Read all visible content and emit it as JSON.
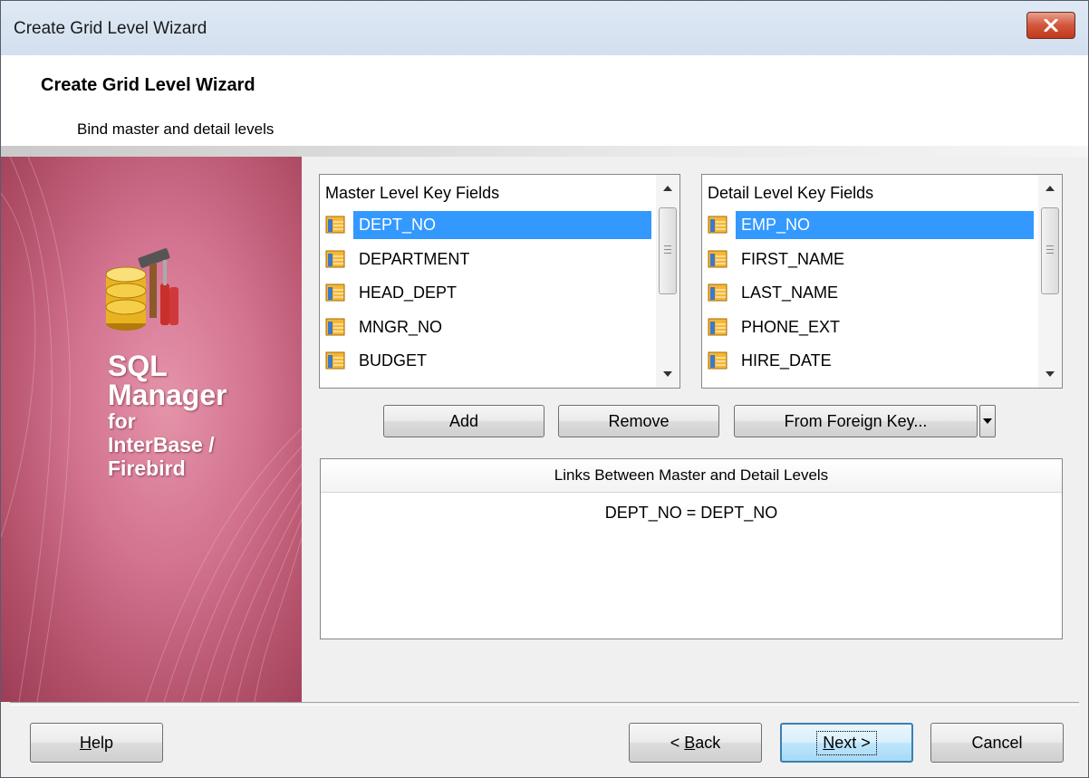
{
  "window": {
    "title": "Create Grid Level Wizard"
  },
  "header": {
    "title": "Create Grid Level Wizard",
    "subtitle": "Bind master and detail levels"
  },
  "banner": {
    "line1": "SQL",
    "line2": "Manager",
    "line3": "for",
    "line4": "InterBase /",
    "line5": "Firebird",
    "icon": "database-tools-icon"
  },
  "master_list": {
    "header": "Master Level Key Fields",
    "items": [
      "DEPT_NO",
      "DEPARTMENT",
      "HEAD_DEPT",
      "MNGR_NO",
      "BUDGET"
    ],
    "selected": "DEPT_NO"
  },
  "detail_list": {
    "header": "Detail Level Key Fields",
    "items": [
      "EMP_NO",
      "FIRST_NAME",
      "LAST_NAME",
      "PHONE_EXT",
      "HIRE_DATE"
    ],
    "selected": "EMP_NO"
  },
  "buttons": {
    "add": "Add",
    "remove": "Remove",
    "from_foreign_key": "From Foreign Key...",
    "help_u": "H",
    "help_rest": "elp",
    "back_pre": "< ",
    "back_u": "B",
    "back_rest": "ack",
    "next_u": "N",
    "next_rest": "ext >",
    "cancel": "Cancel"
  },
  "links": {
    "header": "Links Between Master and Detail Levels",
    "rows": [
      "DEPT_NO = DEPT_NO"
    ]
  },
  "colors": {
    "selection": "#3399ff",
    "banner": "#c6607c",
    "close": "#c7432a"
  }
}
